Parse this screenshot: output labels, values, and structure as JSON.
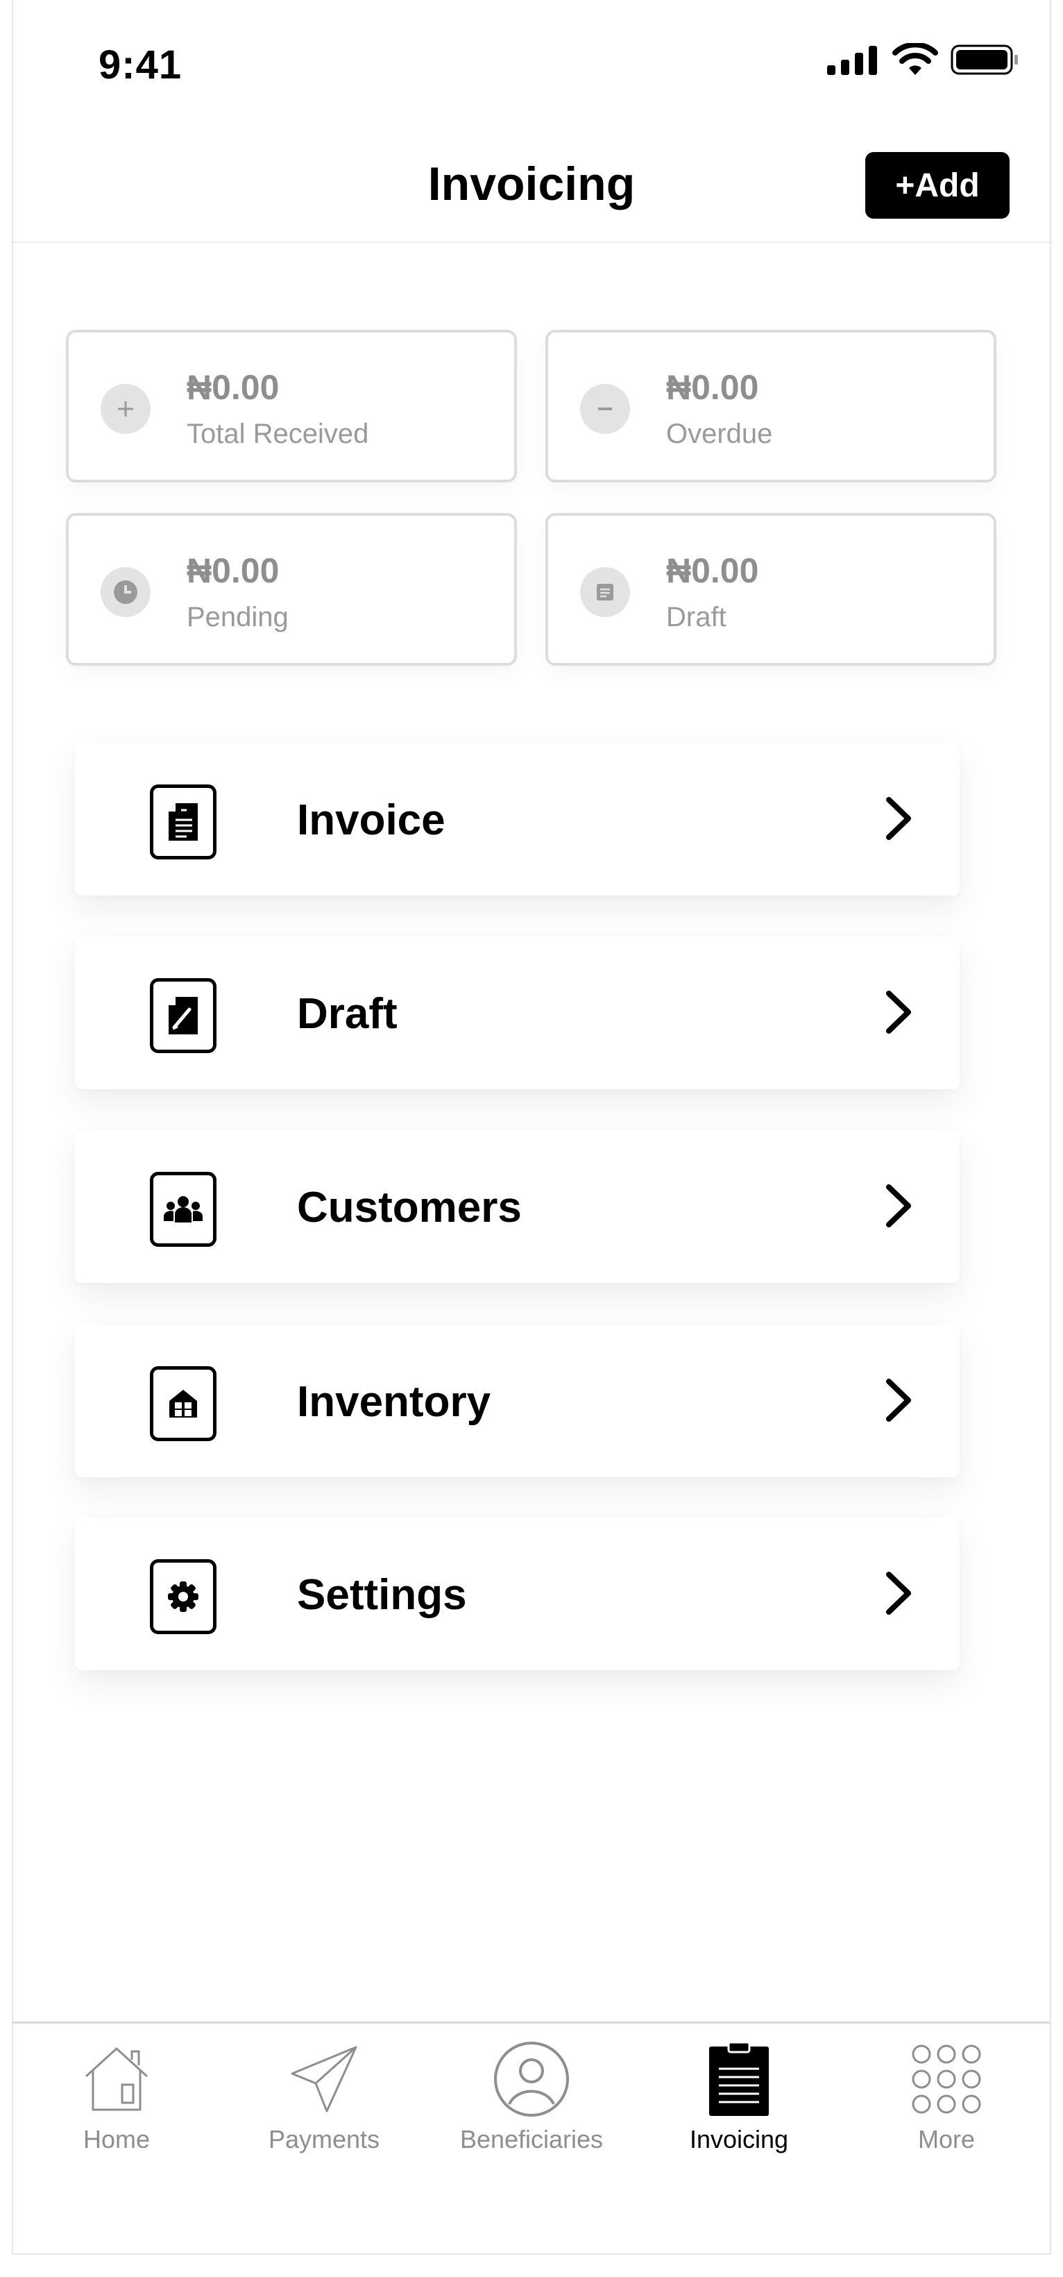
{
  "status_bar": {
    "time": "9:41"
  },
  "header": {
    "title": "Invoicing",
    "add_label": "+Add"
  },
  "summary": [
    {
      "amount": "₦0.00",
      "label": "Total Received",
      "icon": "plus-icon"
    },
    {
      "amount": "₦0.00",
      "label": "Overdue",
      "icon": "minus-icon"
    },
    {
      "amount": "₦0.00",
      "label": "Pending",
      "icon": "clock-icon"
    },
    {
      "amount": "₦0.00",
      "label": "Draft",
      "icon": "document-icon"
    }
  ],
  "menu": [
    {
      "label": "Invoice",
      "icon": "invoice-icon"
    },
    {
      "label": "Draft",
      "icon": "draft-icon"
    },
    {
      "label": "Customers",
      "icon": "customers-icon"
    },
    {
      "label": "Inventory",
      "icon": "inventory-icon"
    },
    {
      "label": "Settings",
      "icon": "settings-icon"
    }
  ],
  "tabbar": {
    "tabs": [
      {
        "label": "Home",
        "icon": "home-icon",
        "active": false
      },
      {
        "label": "Payments",
        "icon": "paper-plane-icon",
        "active": false
      },
      {
        "label": "Beneficiaries",
        "icon": "user-circle-icon",
        "active": false
      },
      {
        "label": "Invoicing",
        "icon": "clipboard-icon",
        "active": true
      },
      {
        "label": "More",
        "icon": "grid-dots-icon",
        "active": false
      }
    ]
  },
  "colors": {
    "accent": "#000000",
    "muted": "#8e8e8e",
    "border": "#dcdcdc"
  }
}
